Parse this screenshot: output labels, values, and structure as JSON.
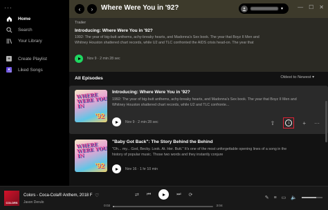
{
  "sidebar": {
    "menu_dots": "···",
    "items": [
      {
        "label": "Home",
        "icon": "home-icon"
      },
      {
        "label": "Search",
        "icon": "search-icon"
      },
      {
        "label": "Your Library",
        "icon": "library-icon"
      }
    ],
    "playlist_items": [
      {
        "label": "Create Playlist",
        "icon": "plus-square-icon"
      },
      {
        "label": "Liked Songs",
        "icon": "heart-square-icon"
      }
    ]
  },
  "topbar": {
    "title": "Where Were You in '92?",
    "back": "‹",
    "forward": "›",
    "caret": "▾"
  },
  "window_controls": {
    "minimize": "—",
    "maximize": "☐",
    "close": "✕"
  },
  "trailer": {
    "label": "Trailer",
    "title": "Introducing: Where Were You in '92?",
    "description": "1992: The year of big-butt anthems, achy-breaky hearts, and Madonna's Sex book. The year that Boyz II Men and Whitney Houston shattered chart records, while U2 and TLC confronted the AIDS crisis head-on. The year that",
    "meta": "Nov 9 · 2 min 28 sec"
  },
  "episodes_header": {
    "label": "All Episodes",
    "sort_label": "Oldest to Newest",
    "sort_caret": "▾"
  },
  "episodes": [
    {
      "title": "Introducing: Where Were You in '92?",
      "description": "1992: The year of big-butt anthems, achy-breaky hearts, and Madonna's Sex book. The year that Boyz II Men and Whitney Houston shattered chart records, while U2 and TLC confronte...",
      "meta": "Nov 9 · 2 min 28 sec",
      "art_text": "WHERE WERE YOU IN",
      "art_num": "'92"
    },
    {
      "title": "\"Baby Got Back\": The Story Behind the Behind",
      "description": "\"Oh... my... God, Becky. Look. At. Her. Butt.\" It's one of the most unforgettable opening lines of a song in the history of popular music. Those two words and they instantly conjure",
      "meta": "Nov 16 · 1 hr 10 min",
      "art_text": "WHERE WERE YOU IN",
      "art_num": "'92"
    }
  ],
  "action_icons": {
    "share": "⇧",
    "download": "↓",
    "add": "+",
    "more": "···"
  },
  "player": {
    "art_label": "COLORS",
    "title": "Colors - Coca-Cola® Anthem, 2018 F",
    "artist": "Jason Derulo",
    "heart": "♡",
    "shuffle": "⇄",
    "prev": "⏮",
    "next": "⏭",
    "repeat": "⟳",
    "time_elapsed": "0:02",
    "time_total": "3:04",
    "progress": 0.01,
    "volume": 0.7,
    "right_icons": {
      "mic": "✎",
      "queue": "≡",
      "device": "▭",
      "volume": "🔈"
    }
  }
}
